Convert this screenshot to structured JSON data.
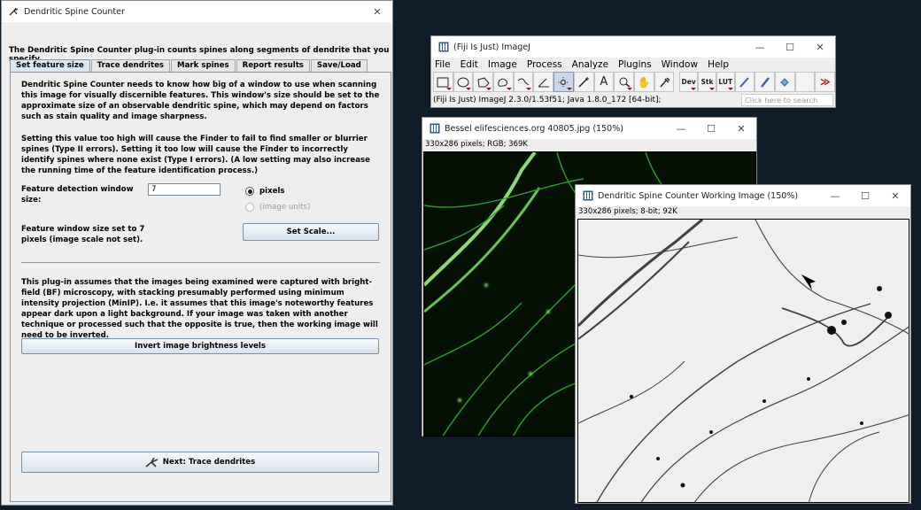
{
  "spine_window": {
    "title": "Dendritic Spine Counter",
    "intro": "The Dendritic Spine Counter plug-in counts spines along segments of dendrite that you specify.",
    "tabs": [
      "Set feature size",
      "Trace dendrites",
      "Mark spines",
      "Report results",
      "Save/Load"
    ],
    "active_tab": "Set feature size",
    "para1": "Dendritic Spine Counter needs to know how big of a window to use when scanning this image for visually discernible features. This window's size should be set to the approximate size of an observable dendritic spine, which may depend on factors such as stain quality and image sharpness.",
    "para2": "Setting this value too high will cause the Finder to fail to find smaller or blurrier spines (Type II errors). Setting it too low will cause the Finder to incorrectly identify spines where none exist (Type I errors). (A low setting may also increase the running time of the feature identification process.)",
    "feature_label": "Feature detection window size:",
    "feature_value": "7",
    "radio_pixels": "pixels",
    "radio_image_units": "(image units)",
    "window_size_status": "Feature window size set to 7 pixels (image scale not set).",
    "set_scale_button": "Set Scale...",
    "para3": "This plug-in assumes that the images being examined were captured with bright-field (BF) microscopy, with stacking presumably performed using minimum intensity projection (MinIP). I.e. it assumes that this image's noteworthy features appear dark upon a light background. If your image was taken with another technique or processed such that the opposite is true, then the working image will need to be inverted.",
    "invert_button": "Invert image brightness levels",
    "next_button": "Next: Trace dendrites"
  },
  "imagej_window": {
    "title": "(Fiji Is Just) ImageJ",
    "menus": [
      "File",
      "Edit",
      "Image",
      "Process",
      "Analyze",
      "Plugins",
      "Window",
      "Help"
    ],
    "tools": [
      "rectangle",
      "oval",
      "polygon",
      "freehand",
      "line",
      "angle",
      "point",
      "wand",
      "text",
      "magnifier",
      "hand",
      "dropper"
    ],
    "extra_tools": [
      "Dev",
      "Stk",
      "LUT"
    ],
    "status": "(Fiji Is Just) ImageJ 2.3.0/1.53f51; Java 1.8.0_172 [64-bit];",
    "search_placeholder": "Click here to search"
  },
  "bessel_window": {
    "title": "Bessel elifesciences.org 40805.jpg (150%)",
    "info": "330x286 pixels; RGB; 369K"
  },
  "working_window": {
    "title": "Dendritic Spine Counter Working Image (150%)",
    "info": "330x286 pixels; 8-bit; 92K"
  }
}
